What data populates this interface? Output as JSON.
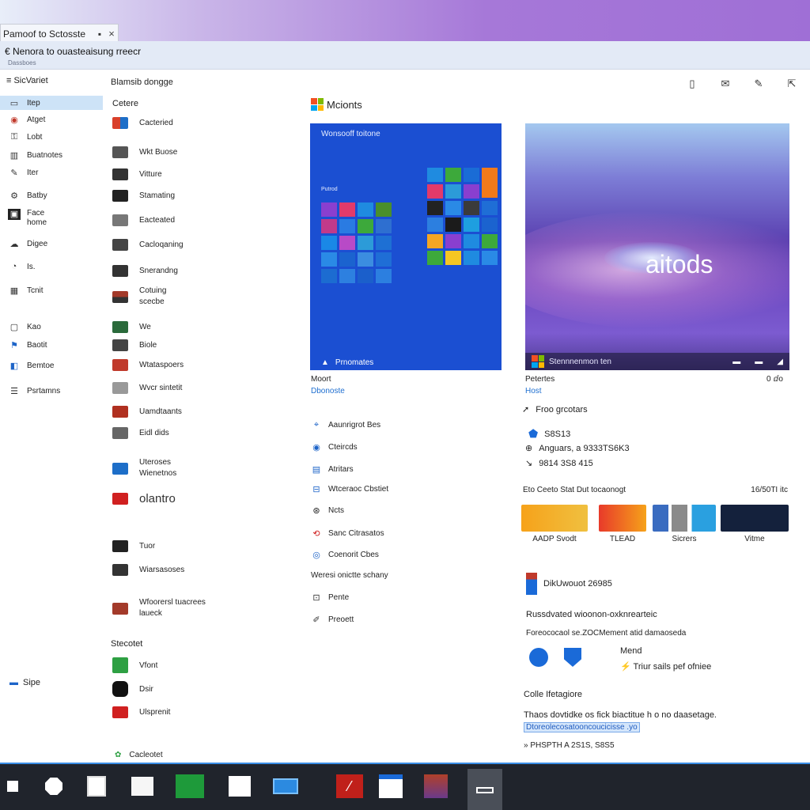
{
  "window": {
    "tab_title": "Pamoof to Sctosste",
    "tab_close": "×",
    "subtitle": "€ Nenora to ouasteaisung rreecr",
    "subtitle_hint": "Dassboes"
  },
  "sidebar": {
    "heading": "≡ SicVariet",
    "items": [
      {
        "label": "Itep",
        "icon": "item-icon",
        "active": true
      },
      {
        "label": "Atget",
        "icon": "target-icon"
      },
      {
        "label": "Lobt",
        "icon": "lock-icon"
      },
      {
        "label": "Buatnotes",
        "icon": "notes-icon"
      },
      {
        "label": "Iter",
        "icon": "pen-icon"
      },
      {
        "label": "Batby",
        "icon": "settings-icon"
      },
      {
        "label": "Face home",
        "icon": "home-icon"
      },
      {
        "label": "Digee",
        "icon": "cloud-icon"
      },
      {
        "label": "Is.",
        "icon": "info-icon"
      },
      {
        "label": "Tcnit",
        "icon": "grid-icon"
      },
      {
        "label": "Kao",
        "icon": "folder-icon"
      },
      {
        "label": "Baotit",
        "icon": "bookmark-icon"
      },
      {
        "label": "Bemtoe",
        "icon": "window-icon"
      },
      {
        "label": "Psrtamns",
        "icon": "sliders-icon"
      }
    ],
    "footer": "Sipe"
  },
  "col2": {
    "heading": "Blamsib dongge",
    "subheading": "Cetere",
    "items": [
      {
        "label": "Cacteried",
        "color": "#d9402b"
      },
      {
        "label": "Wkt Buose",
        "color": "#555555"
      },
      {
        "label": "Vitture",
        "color": "#333333"
      },
      {
        "label": "Stamating",
        "color": "#222222"
      },
      {
        "label": "Eacteated",
        "color": "#666666"
      },
      {
        "label": "Cacloqaning",
        "color": "#444444"
      },
      {
        "label": "Snerandng",
        "color": "#333333"
      },
      {
        "label": "Cotuing scecbe",
        "color": "#a33a2a"
      },
      {
        "label": "We",
        "color": "#2a6a3b"
      },
      {
        "label": "Biole",
        "color": "#444444"
      },
      {
        "label": "Wtataspoers",
        "color": "#c0392b"
      },
      {
        "label": "Wvcr sintetit",
        "color": "#777777"
      },
      {
        "label": "Uamdtaants",
        "color": "#b03020"
      },
      {
        "label": "Eidl dids",
        "color": "#555555"
      },
      {
        "label": "Uteroses Wienetnos",
        "color": "#1d6ec8"
      },
      {
        "label": "olantro",
        "color": "#d02020"
      },
      {
        "label": "Tuor",
        "color": "#222222"
      },
      {
        "label": "Wiarsasoses",
        "color": "#333333"
      },
      {
        "label": "Wfoorersl tuacrees laueck",
        "color": "#444444"
      }
    ],
    "section": "Stecotet",
    "section_items": [
      {
        "label": "Vfont",
        "color": "#2ea043"
      },
      {
        "label": "Dsir",
        "color": "#111111"
      },
      {
        "label": "Ulsprenit",
        "color": "#d02020"
      }
    ],
    "footer": "Cacleotet"
  },
  "main": {
    "brand": "Mcionts",
    "card_a": {
      "title": "Wonsooff toitone",
      "label": "Putrod",
      "caption": "Prnomates"
    },
    "card_b": {
      "word": "aitods",
      "caption": "Stennnenmon ten"
    },
    "left_meta": {
      "title": "Moort",
      "link": "Dbonoste"
    },
    "right_meta": {
      "title": "Petertes",
      "link": "Host",
      "extra": "0 ⅆo"
    },
    "feature": "Froo grcotars",
    "stats": [
      {
        "icon": "shield-icon",
        "value": "S8S13"
      },
      {
        "icon": "globe-icon",
        "value": "Anguars, a 9333TS6K3"
      },
      {
        "icon": "call-icon",
        "value": "9814 3S8 415"
      }
    ],
    "list": [
      {
        "label": "Aaunrigrot Bes",
        "icon": "map-pin-icon"
      },
      {
        "label": "Cteircds",
        "icon": "eye-icon"
      },
      {
        "label": "Atritars",
        "icon": "document-icon"
      },
      {
        "label": "Wtceraoc Cbstiet",
        "icon": "tags-icon"
      },
      {
        "label": "Ncts",
        "icon": "network-icon"
      },
      {
        "label": "Sanc Citrasatos",
        "icon": "sync-icon"
      },
      {
        "label": "Coenorit Cbes",
        "icon": "globe-icon"
      }
    ],
    "list_section": "Weresi onictte schany",
    "list_after": [
      {
        "label": "Pente",
        "icon": "square-icon"
      },
      {
        "label": "Preoett",
        "icon": "pencil-icon"
      }
    ],
    "apps_heading": "Eto Ceeto Stat Dut tocaonogt",
    "apps_right": "16/50TI itc",
    "apps": [
      {
        "caption": "AADP Svodt",
        "color": "#f6a21a"
      },
      {
        "caption": "TLEAD",
        "color": "#e83a2a"
      },
      {
        "caption": "Sicrers",
        "color": "#3a6cc0"
      },
      {
        "caption": "Vitme",
        "color": "#14213c"
      }
    ],
    "download": "DikUwouot 26985",
    "support_title": "Russdvated wioonon-oxknrearteic",
    "support_text": "Foreococaol se.ZOCMement atid damaoseda",
    "mend": "Mend",
    "trust": "⚡ Triur sails pef ofniee",
    "prefix_title": "Colle Ifetagiore",
    "prefix_text": "Thaos dovtidke os fick biactitue h o no daasetage.",
    "prefix_link": "Dtoreolecosatooncoucicisse .yo",
    "prefix_code": "» PHSPTH A 2S1S, S8S5"
  },
  "taskbar": {
    "items": [
      {
        "name": "start-icon"
      },
      {
        "name": "search-icon"
      },
      {
        "name": "notepad-icon"
      },
      {
        "name": "tasks-icon"
      },
      {
        "name": "store-icon"
      },
      {
        "name": "document-icon"
      },
      {
        "name": "photos-icon"
      },
      {
        "name": "reader-icon"
      },
      {
        "name": "chart-icon"
      },
      {
        "name": "media-icon"
      },
      {
        "name": "window-icon"
      }
    ]
  },
  "colors": {
    "accent": "#1b4fd2",
    "link": "#1f6fd0",
    "taskbar": "#20242c"
  }
}
